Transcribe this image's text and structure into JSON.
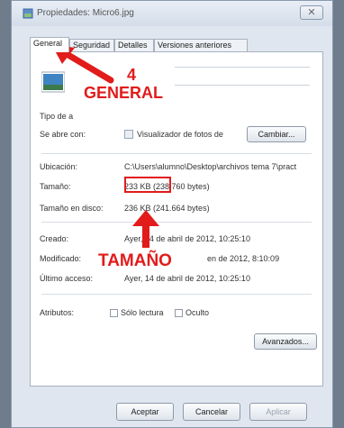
{
  "window": {
    "title": "Propiedades: Micro6.jpg",
    "close_label": "✕",
    "buttons": {
      "accept": "Aceptar",
      "cancel": "Cancelar",
      "apply": "Aplicar"
    }
  },
  "tabs": [
    {
      "label": "General",
      "active": true
    },
    {
      "label": "Seguridad",
      "active": false
    },
    {
      "label": "Detalles",
      "active": false
    },
    {
      "label": "Versiones anteriores",
      "active": false
    }
  ],
  "general": {
    "type_label": "Tipo de a",
    "opens_with_label": "Se abre con:",
    "opens_with_value": "Visualizador de fotos de",
    "change_button": "Cambiar...",
    "location_label": "Ubicación:",
    "location_value": "C:\\Users\\alumno\\Desktop\\archivos tema 7\\pract",
    "size_label": "Tamaño:",
    "size_value": "233 KB (238.760 bytes)",
    "size_on_disk_label": "Tamaño en disco:",
    "size_on_disk_value": "236 KB (241.664 bytes)",
    "created_label": "Creado:",
    "created_value": "Ayer, 14 de abril de 2012, 10:25:10",
    "modified_label": "Modificado:",
    "modified_value": "en de 2012, 8:10:09",
    "accessed_label": "Último acceso:",
    "accessed_value": "Ayer, 14 de abril de 2012, 10:25:10",
    "attributes_label": "Atributos:",
    "readonly_label": "Sólo lectura",
    "hidden_label": "Oculto",
    "advanced_button": "Avanzados..."
  },
  "annotations": {
    "step_number": "4",
    "general_label": "GENERAL",
    "size_label": "TAMAÑO"
  },
  "colors": {
    "annotation": "#e21b1b"
  }
}
